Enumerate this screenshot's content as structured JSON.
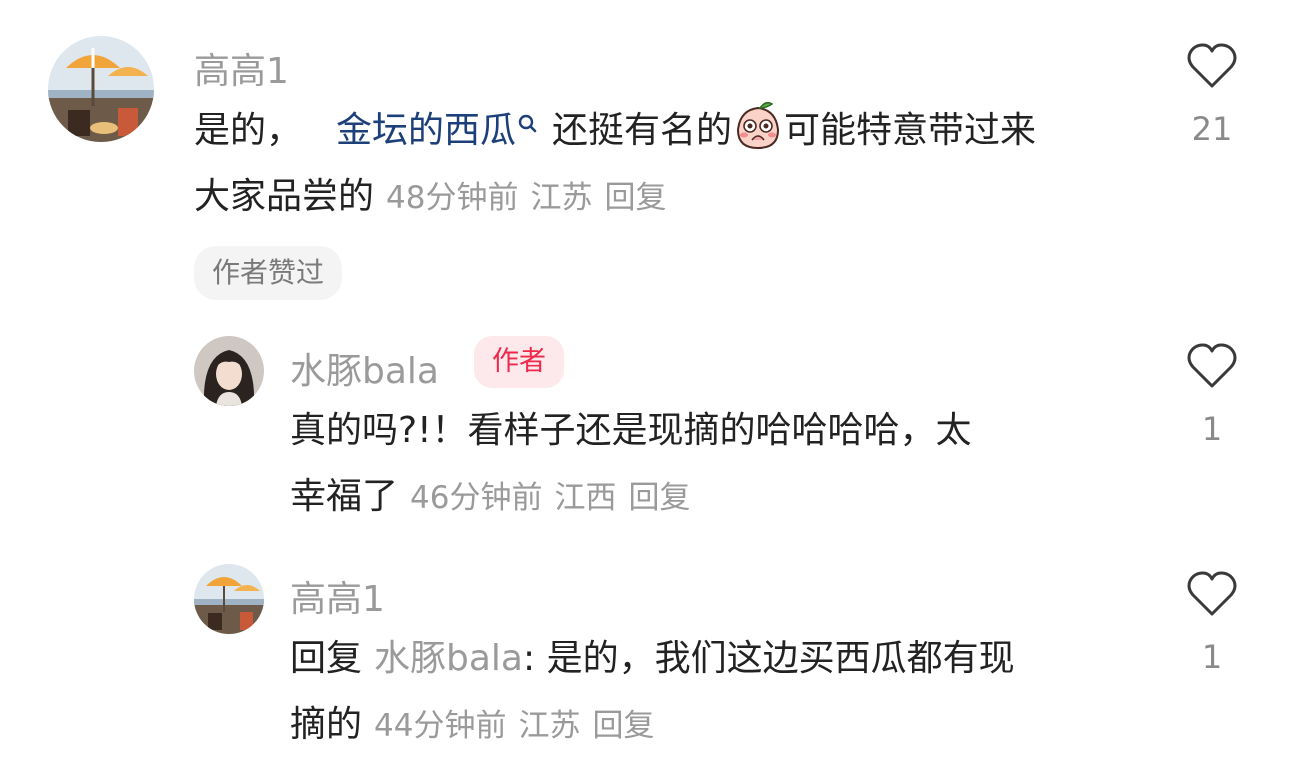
{
  "comments": [
    {
      "username": "高高1",
      "text_prefix": "是的，",
      "keyword": "金坛的西瓜",
      "text_mid": "还挺有名的",
      "text_suffix": "可能特意带过来",
      "text_line2": "大家品尝的",
      "time": "48分钟前",
      "location": "江苏",
      "reply_label": "回复",
      "likes": "21",
      "author_liked": "作者赞过"
    },
    {
      "username": "水豚bala",
      "badge": "作者",
      "text_line1": "真的吗?!！看样子还是现摘的哈哈哈哈，太",
      "text_line2": "幸福了",
      "time": "46分钟前",
      "location": "江西",
      "reply_label": "回复",
      "likes": "1"
    },
    {
      "username": "高高1",
      "reply_prefix": "回复",
      "reply_to": "水豚bala",
      "text_line1": ": 是的，我们这边买西瓜都有现",
      "text_line2": "摘的",
      "time": "44分钟前",
      "location": "江苏",
      "reply_label": "回复",
      "likes": "1"
    }
  ],
  "icons": {
    "like": "heart-outline-icon",
    "search": "search-icon",
    "emoji": "shy-peach-emoji-icon"
  },
  "colors": {
    "keyword": "#1d3f7a",
    "meta": "#9a9a9a",
    "badge_bg": "#fde9ec",
    "badge_text": "#f0284a"
  }
}
